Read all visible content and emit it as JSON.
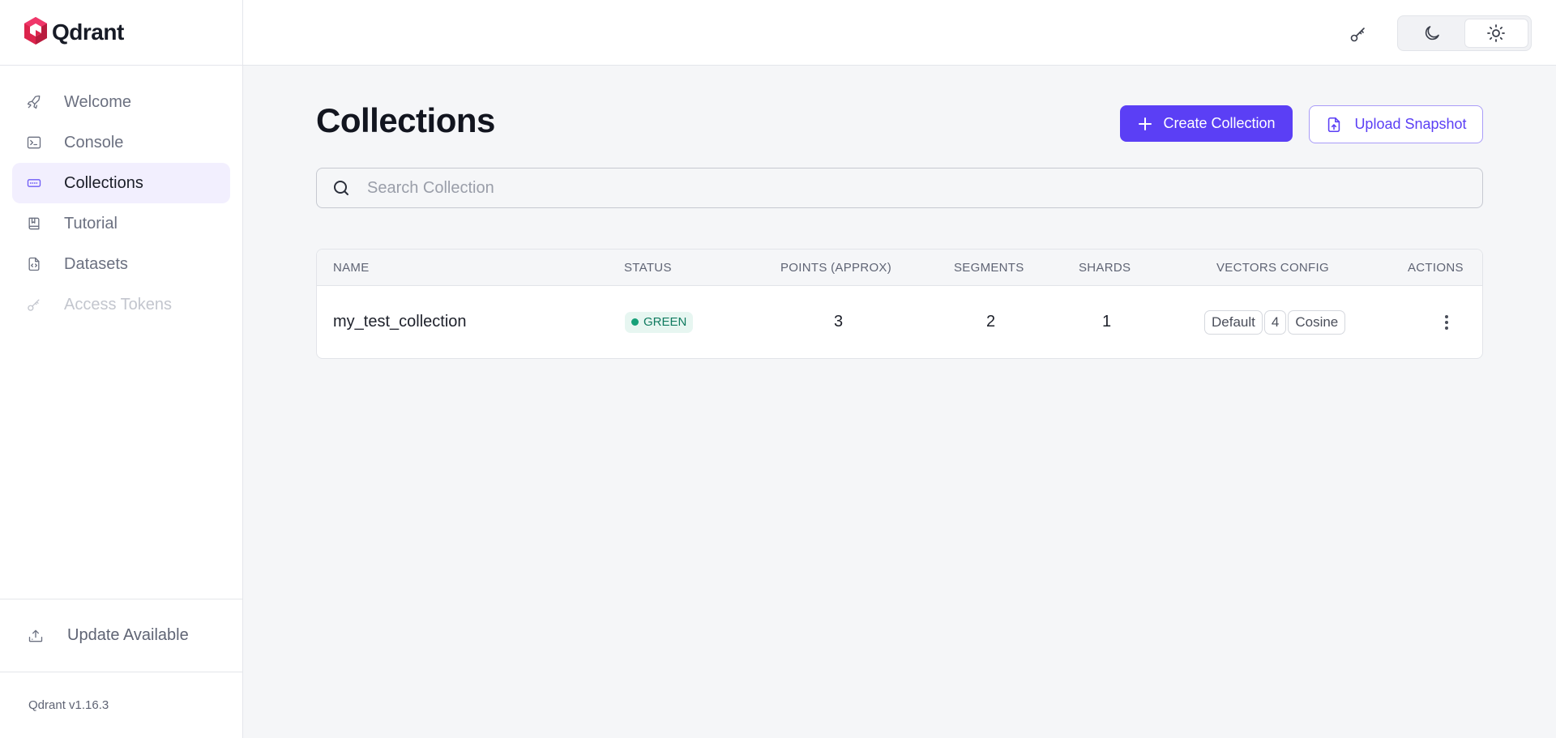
{
  "brand": {
    "name": "Qdrant",
    "logo_icon": "qdrant-logo-icon"
  },
  "sidebar": {
    "items": [
      {
        "label": "Welcome",
        "icon": "rocket-icon"
      },
      {
        "label": "Console",
        "icon": "terminal-icon"
      },
      {
        "label": "Collections",
        "icon": "collection-icon",
        "active": true
      },
      {
        "label": "Tutorial",
        "icon": "book-icon"
      },
      {
        "label": "Datasets",
        "icon": "file-code-icon"
      },
      {
        "label": "Access Tokens",
        "icon": "key-icon",
        "disabled": true
      }
    ],
    "update_label": "Update Available",
    "version": "Qdrant v1.16.3"
  },
  "topbar": {
    "api_key_icon": "key-icon",
    "theme_options": [
      "dark",
      "light"
    ],
    "selected_theme": "light"
  },
  "main": {
    "title": "Collections",
    "create_label": "Create Collection",
    "upload_label": "Upload Snapshot",
    "search_placeholder": "Search Collection",
    "search_value": ""
  },
  "table": {
    "headers": {
      "name": "NAME",
      "status": "STATUS",
      "points": "POINTS (APPROX)",
      "segments": "SEGMENTS",
      "shards": "SHARDS",
      "vectors": "VECTORS CONFIG",
      "actions": "ACTIONS"
    },
    "rows": [
      {
        "name": "my_test_collection",
        "status": "GREEN",
        "points": "3",
        "segments": "2",
        "shards": "1",
        "vectors": {
          "name": "Default",
          "size": "4",
          "distance": "Cosine"
        }
      }
    ]
  },
  "colors": {
    "accent": "#5b3ff5",
    "status_green": "#16a078",
    "active_nav_bg": "#f2effe"
  }
}
